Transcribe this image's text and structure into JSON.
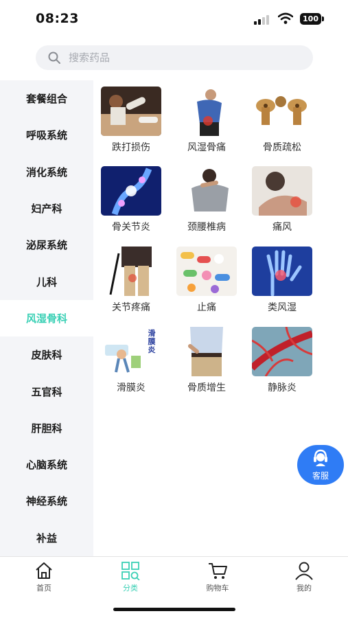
{
  "status_bar": {
    "time": "08:23",
    "battery": "100"
  },
  "search": {
    "placeholder": "搜索药品"
  },
  "sidebar": {
    "items": [
      {
        "label": "套餐组合"
      },
      {
        "label": "呼吸系统"
      },
      {
        "label": "消化系统"
      },
      {
        "label": "妇产科"
      },
      {
        "label": "泌尿系统"
      },
      {
        "label": "儿科"
      },
      {
        "label": "风湿骨科",
        "active": true
      },
      {
        "label": "皮肤科"
      },
      {
        "label": "五官科"
      },
      {
        "label": "肝胆科"
      },
      {
        "label": "心脑系统"
      },
      {
        "label": "神经系统"
      },
      {
        "label": "补益"
      }
    ]
  },
  "grid": {
    "items": [
      {
        "label": "跌打损伤"
      },
      {
        "label": "风湿骨痛"
      },
      {
        "label": "骨质疏松"
      },
      {
        "label": "骨关节炎"
      },
      {
        "label": "颈腰椎病"
      },
      {
        "label": "痛风"
      },
      {
        "label": "关节疼痛"
      },
      {
        "label": "止痛"
      },
      {
        "label": "类风湿"
      },
      {
        "label": "滑膜炎",
        "image_text": "滑膜炎"
      },
      {
        "label": "骨质增生"
      },
      {
        "label": "静脉炎"
      }
    ]
  },
  "service": {
    "label": "客服"
  },
  "tabbar": {
    "tabs": [
      {
        "label": "首页",
        "icon": "home-icon"
      },
      {
        "label": "分类",
        "icon": "category-icon",
        "active": true
      },
      {
        "label": "购物车",
        "icon": "cart-icon"
      },
      {
        "label": "我的",
        "icon": "profile-icon"
      }
    ]
  },
  "colors": {
    "accent": "#3ad0b5",
    "service_blue": "#2f7cf5",
    "sidebar_bg": "#f4f5f8"
  }
}
